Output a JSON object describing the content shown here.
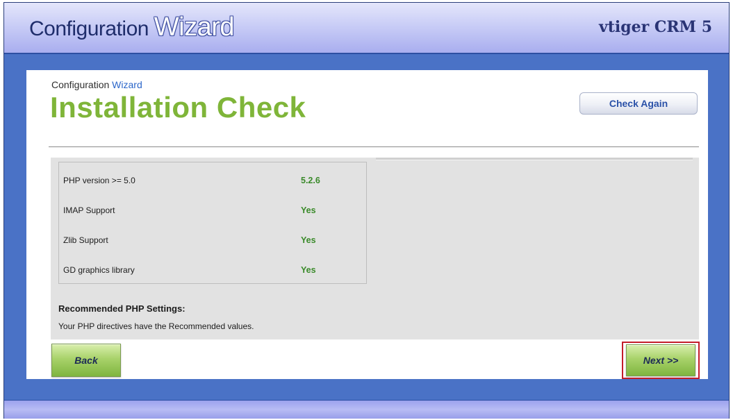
{
  "header": {
    "title_prefix": "Configuration ",
    "title_highlight": "Wizard",
    "brand": "vtiger CRM 5"
  },
  "panel": {
    "small_title_prefix": "Configuration ",
    "small_title_highlight": "Wizard",
    "page_title": "Installation Check",
    "check_again_label": "Check Again"
  },
  "requirements": [
    {
      "label": "PHP version >= 5.0",
      "value": "5.2.6"
    },
    {
      "label": "IMAP Support",
      "value": "Yes"
    },
    {
      "label": "Zlib Support",
      "value": "Yes"
    },
    {
      "label": "GD graphics library",
      "value": "Yes"
    }
  ],
  "recommended": {
    "title": "Recommended PHP Settings:",
    "text": "Your PHP directives have the Recommended values."
  },
  "buttons": {
    "back_label": "Back",
    "next_label": "Next >>"
  },
  "colors": {
    "accent_green": "#7fb539",
    "frame_blue": "#4a72c6",
    "highlight_red": "#c31c2a"
  }
}
